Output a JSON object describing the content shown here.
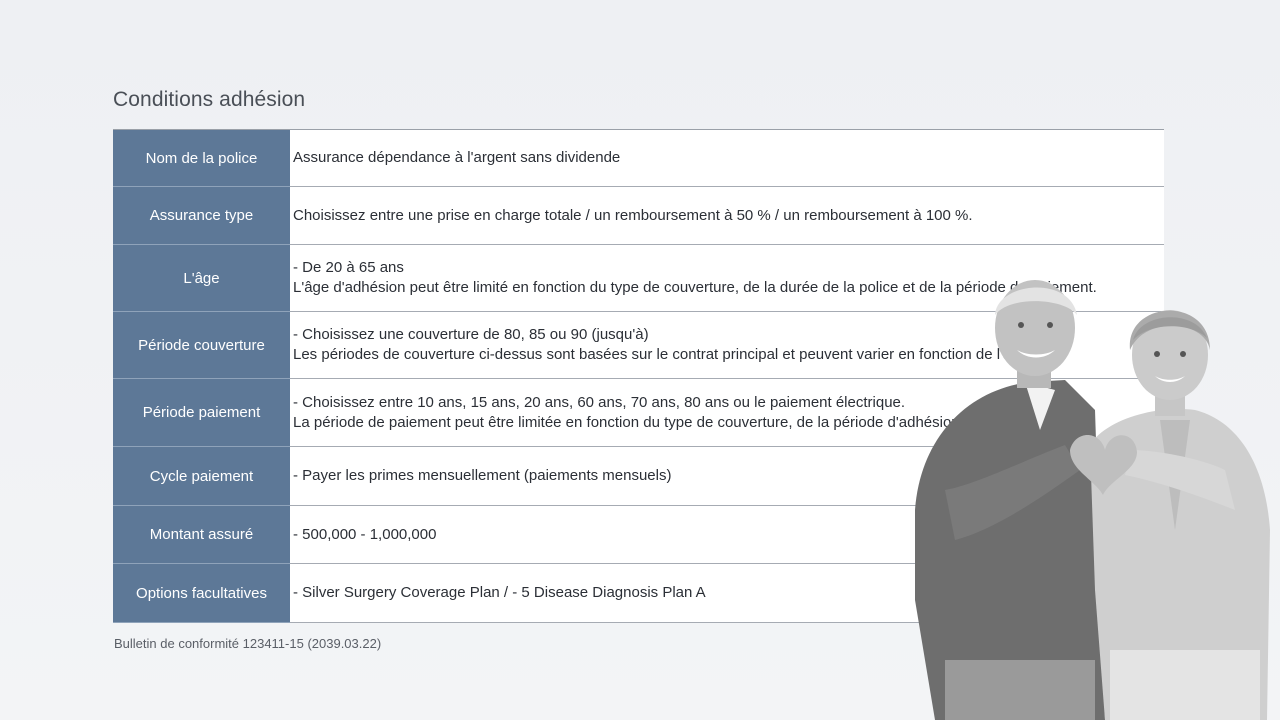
{
  "heading": "Conditions adhésion",
  "rows": [
    {
      "label": "Nom de la police",
      "lines": [
        "Assurance dépendance à l'argent sans dividende"
      ]
    },
    {
      "label": "Assurance type",
      "lines": [
        "Choisissez entre une prise en charge totale / un remboursement à 50 % / un remboursement à 100 %."
      ]
    },
    {
      "label": "L'âge",
      "lines": [
        "- De 20 à 65 ans",
        "L'âge d'adhésion peut être limité en fonction du type de couverture, de la durée de la police et de la période de paiement."
      ]
    },
    {
      "label": "Période couverture",
      "lines": [
        "- Choisissez une couverture de 80, 85 ou 90 (jusqu'à)",
        "Les périodes de couverture ci-dessus sont basées sur le contrat principal et peuvent varier en fonction de l'âge"
      ]
    },
    {
      "label": "Période paiement",
      "lines": [
        "- Choisissez entre 10 ans, 15 ans, 20 ans, 60 ans, 70 ans, 80 ans ou le paiement électrique.",
        "La période de paiement peut être limitée en fonction du type de couverture, de la période d'adhésion"
      ]
    },
    {
      "label": "Cycle paiement",
      "lines": [
        "- Payer les primes mensuellement (paiements mensuels)"
      ]
    },
    {
      "label": "Montant assuré",
      "lines": [
        "- 500,000 - 1,000,000"
      ]
    },
    {
      "label": "Options facultatives",
      "lines": [
        "- Silver Surgery Coverage Plan / - 5 Disease Diagnosis Plan A"
      ]
    }
  ],
  "footnote": "Bulletin de conformité 123411-15 (2039.03.22)",
  "colors": {
    "label_bg": "#5d7897",
    "label_text": "#ffffff",
    "page_bg": "#eef0f3"
  }
}
